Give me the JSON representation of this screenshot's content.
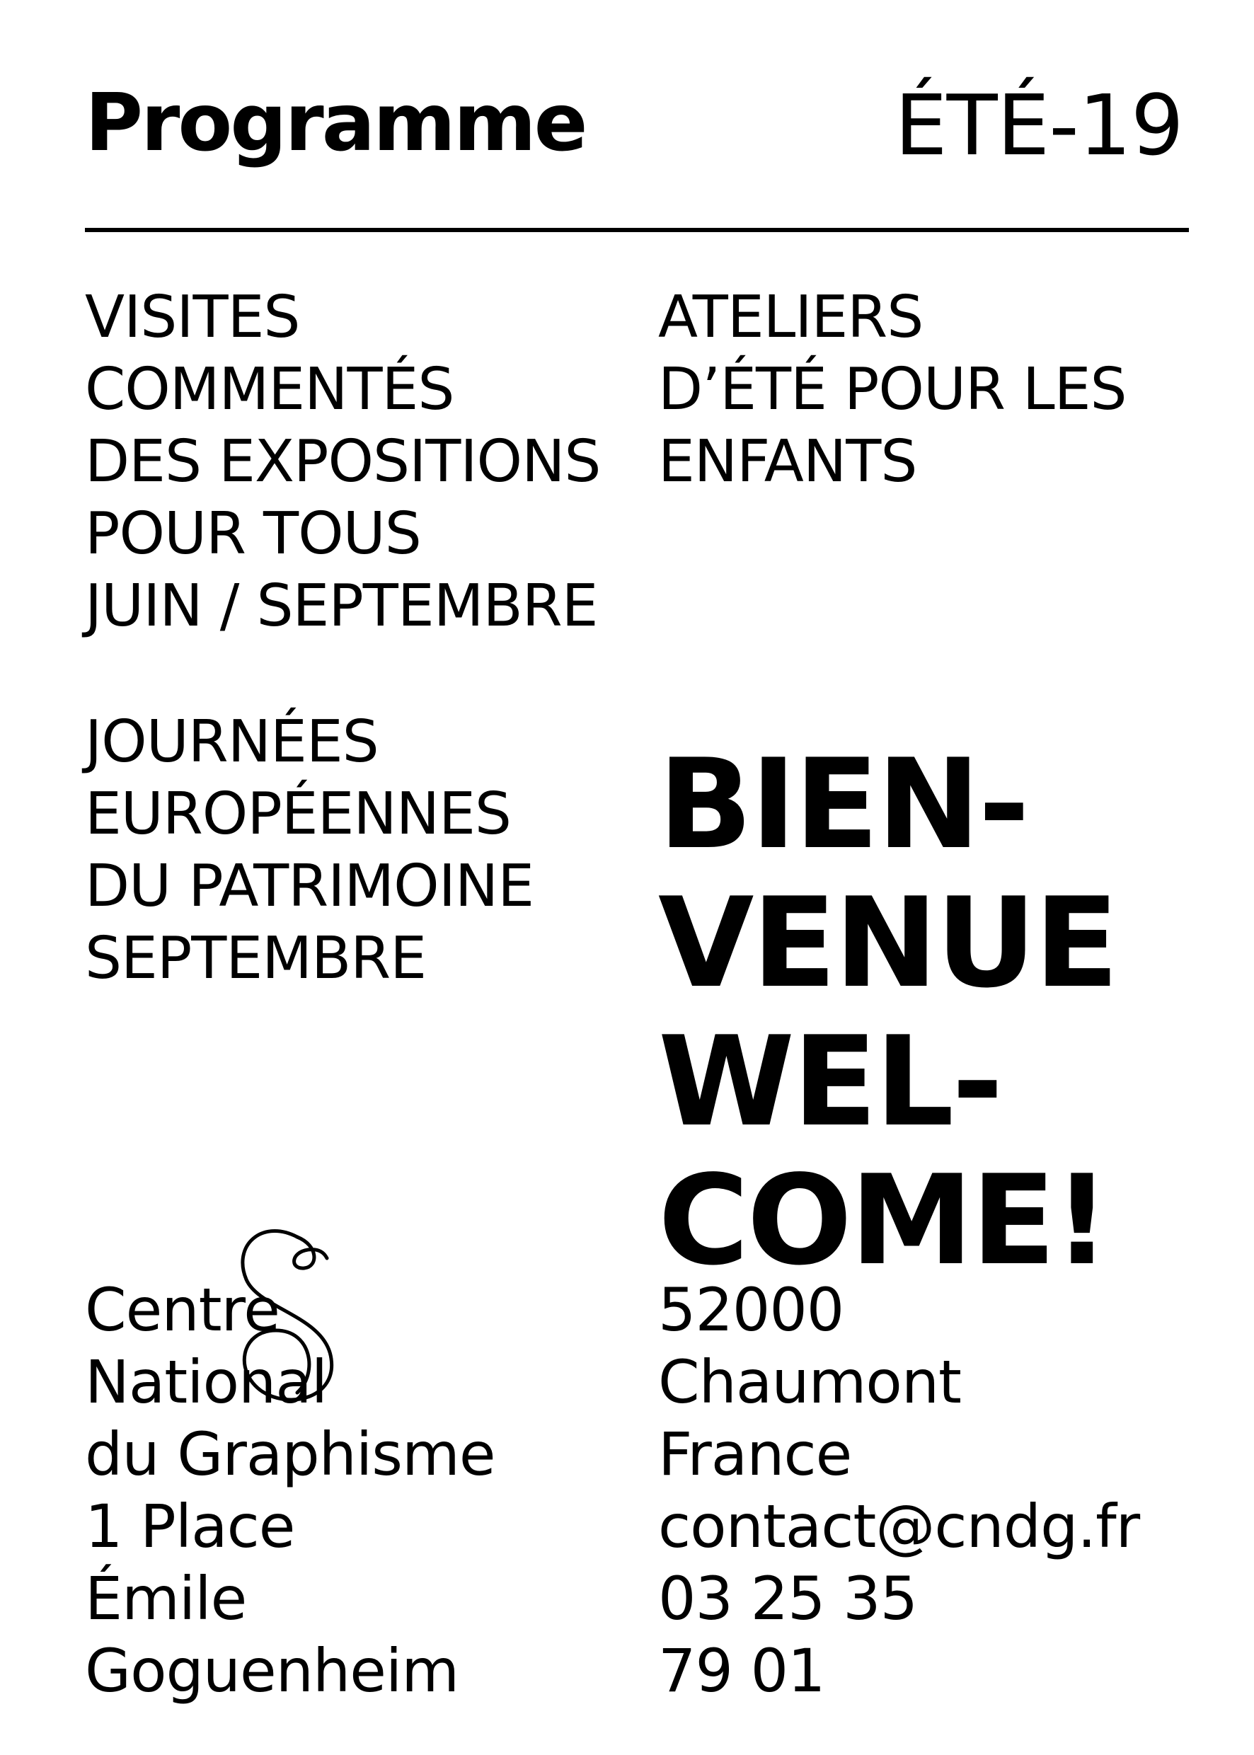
{
  "header": {
    "title": "Programme",
    "season": "ÉTÉ-19"
  },
  "visites": {
    "lines": [
      "VISITES",
      "COMMENTÉS",
      "DES EXPOSITIONS",
      "POUR TOUS",
      "JUIN / SEPTEMBRE"
    ]
  },
  "ateliers": {
    "lines": [
      "ATELIERS",
      "D’ÉTÉ POUR LES",
      "ENFANTS"
    ]
  },
  "journees": {
    "lines": [
      "JOURNÉES",
      "EUROPÉENNES",
      "DU PATRIMOINE",
      "SEPTEMBRE"
    ]
  },
  "welcome": {
    "lines": [
      "BIEN-",
      "VENUE",
      "WEL-",
      "COME!"
    ]
  },
  "address": {
    "left_lines": [
      "Centre",
      "National",
      "du Graphisme",
      "1 Place",
      "Émile",
      "Goguenheim"
    ],
    "right_lines": [
      "52000",
      "Chaumont",
      "France",
      "contact@cndg.fr",
      "03 25 35",
      "79 01"
    ]
  },
  "logo": {
    "icon": "cndg-monogram-icon"
  }
}
